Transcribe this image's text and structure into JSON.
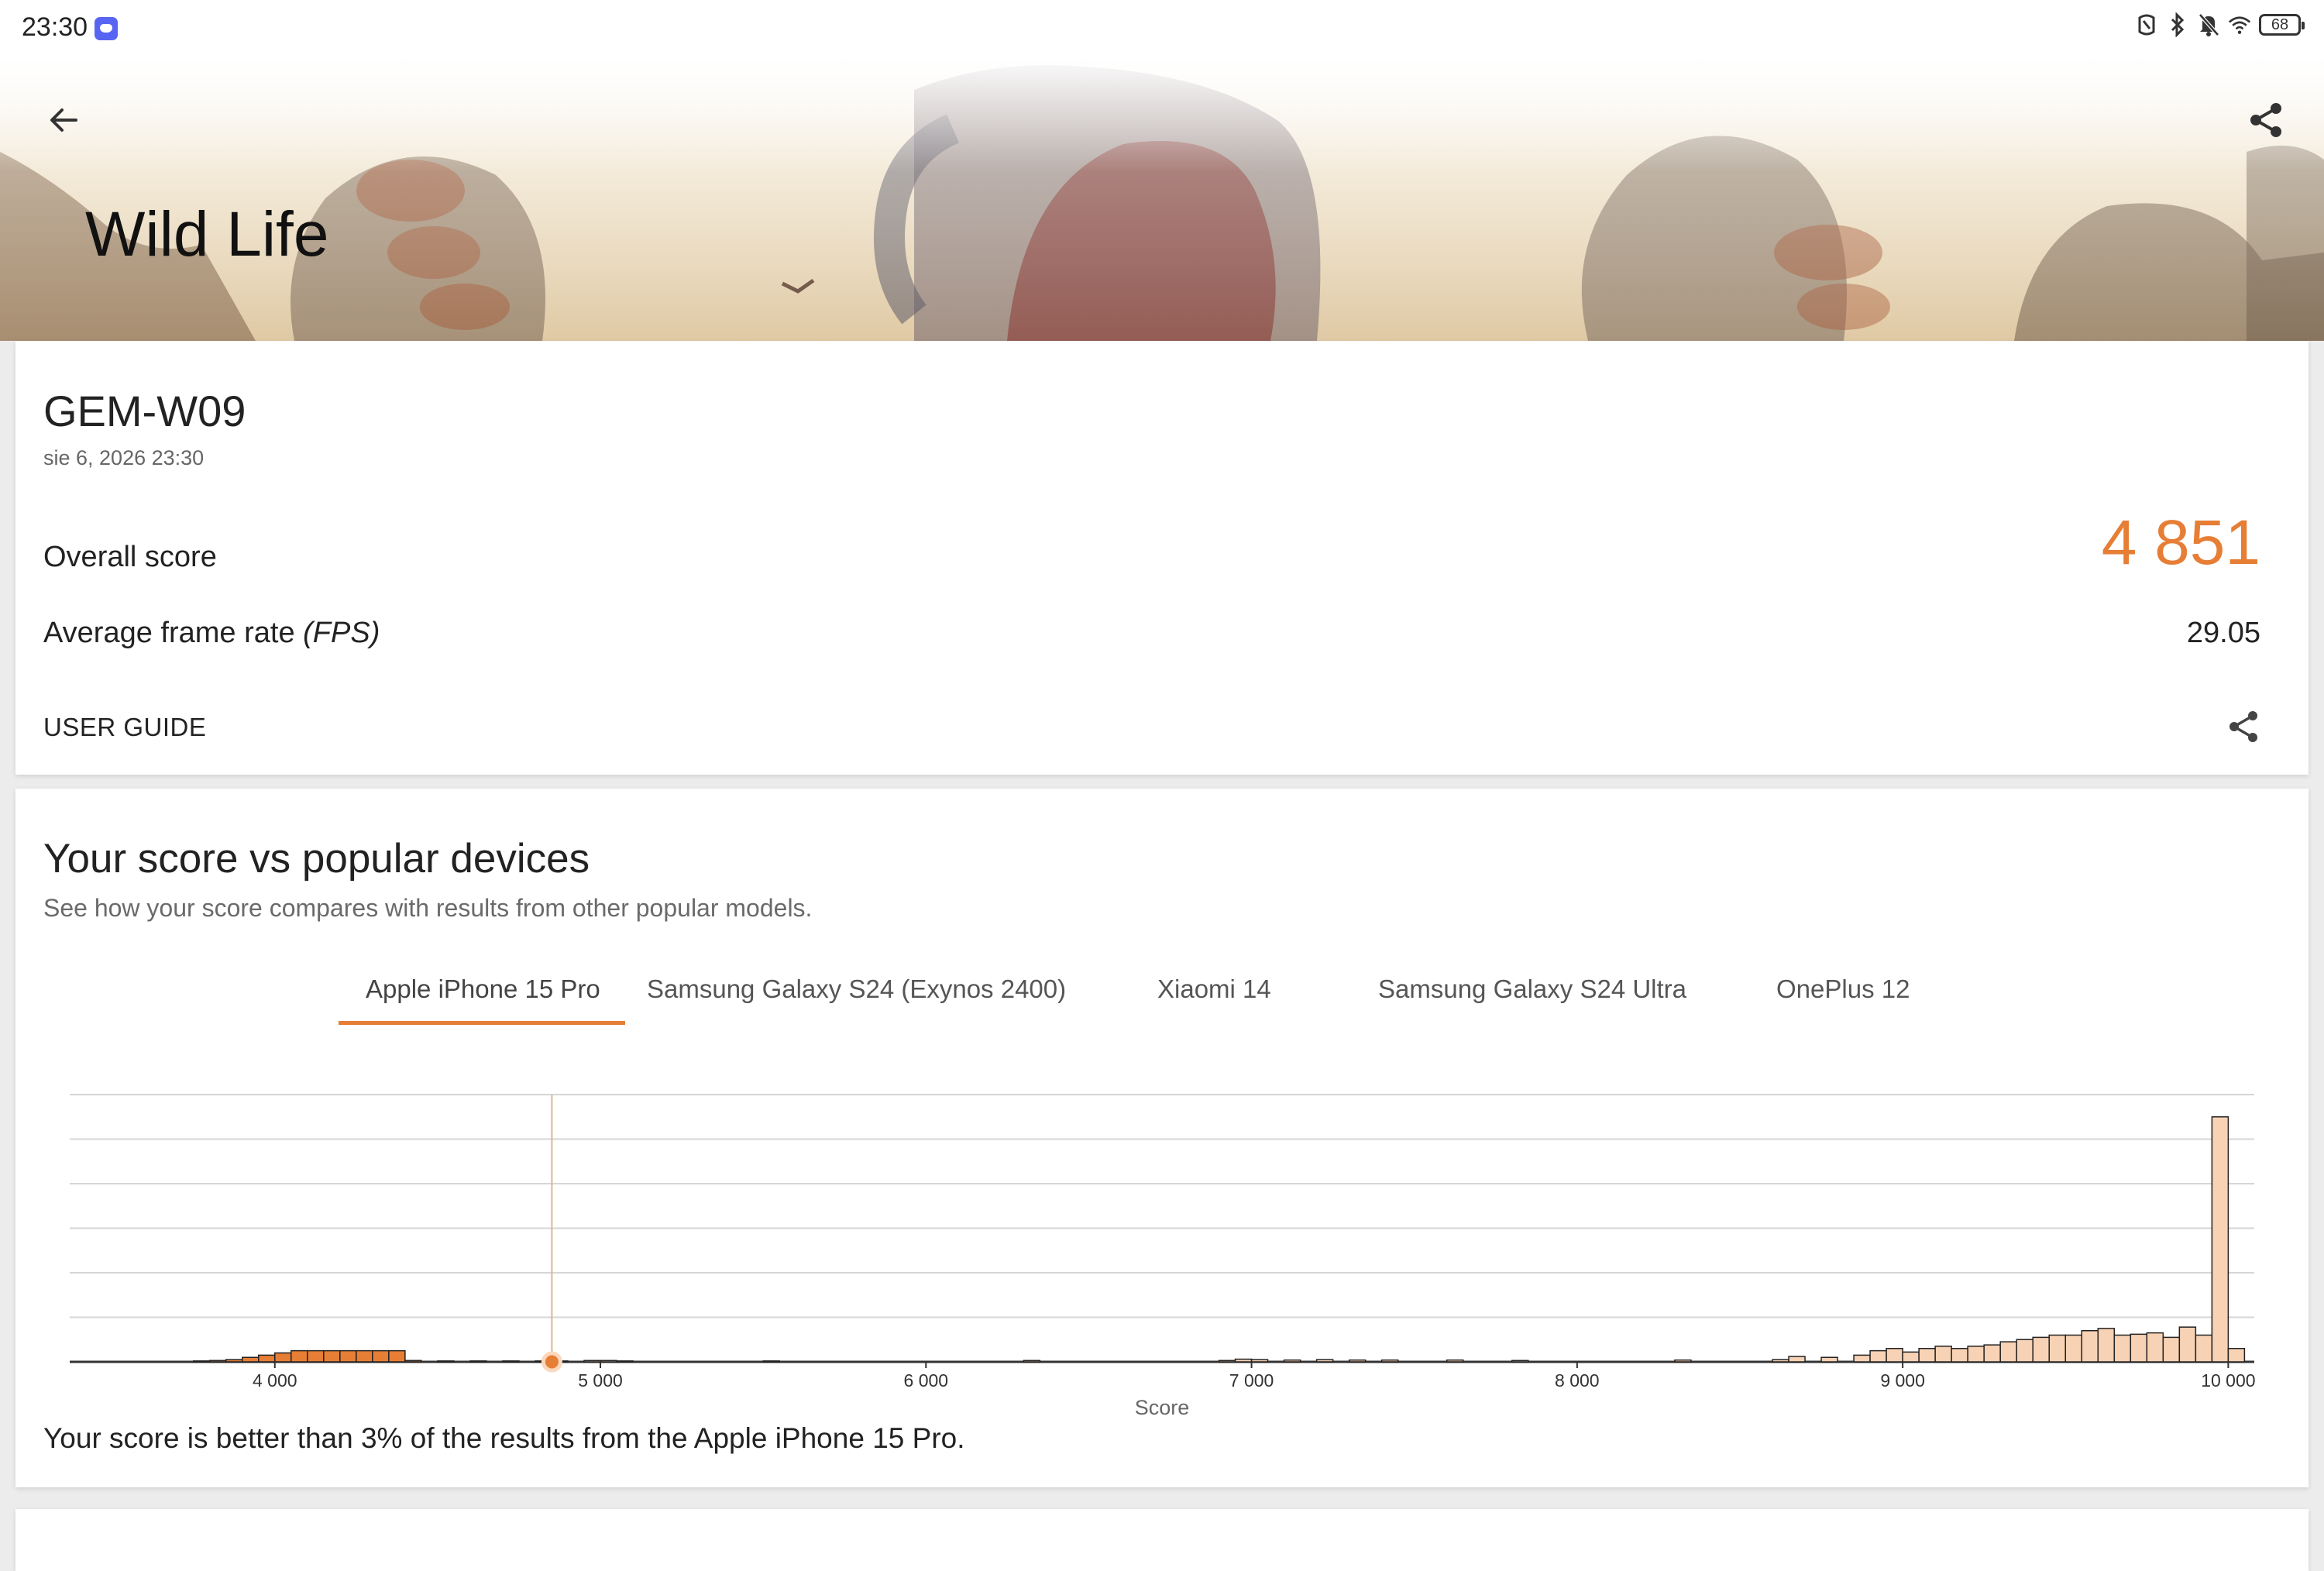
{
  "status_bar": {
    "time": "23:30",
    "battery": "68",
    "icons": [
      "discord-icon",
      "nfc-icon",
      "bluetooth-icon",
      "bell-off-icon",
      "wifi-icon",
      "battery-icon"
    ]
  },
  "header": {
    "title": "Wild Life",
    "back_icon": "arrow-left-icon",
    "share_icon": "share-icon"
  },
  "result": {
    "device": "GEM-W09",
    "date": "sie 6, 2026 23:30",
    "overall_label": "Overall score",
    "overall_value": "4 851",
    "fps_label_main": "Average frame rate",
    "fps_label_unit": "(FPS)",
    "fps_value": "29.05",
    "user_guide": "USER GUIDE"
  },
  "comparison": {
    "title": "Your score vs popular devices",
    "subtitle": "See how your score compares with results from other popular models.",
    "tabs": [
      {
        "label": "Apple iPhone 15 Pro",
        "selected": true
      },
      {
        "label": "Samsung Galaxy S24 (Exynos 2400)",
        "selected": false
      },
      {
        "label": "Xiaomi 14",
        "selected": false
      },
      {
        "label": "Samsung Galaxy S24 Ultra",
        "selected": false
      },
      {
        "label": "OnePlus 12",
        "selected": false
      }
    ],
    "result_text": "Your score is better than 3% of the results from the Apple iPhone 15 Pro."
  },
  "chart_data": {
    "type": "area",
    "xlabel": "Score",
    "xlim": [
      3370,
      10080
    ],
    "ylim": [
      0,
      6
    ],
    "grid": true,
    "x_ticks": [
      4000,
      5000,
      6000,
      7000,
      8000,
      9000,
      10000
    ],
    "x_tick_labels": [
      "4 000",
      "5 000",
      "6 000",
      "7 000",
      "8 000",
      "9 000",
      "10 000"
    ],
    "marker": {
      "x": 4851
    },
    "bin_width": 50,
    "series": [
      {
        "color": "#e67e35",
        "highlight_below": 4851,
        "points": [
          [
            3750,
            0.02
          ],
          [
            3800,
            0.03
          ],
          [
            3850,
            0.05
          ],
          [
            3900,
            0.1
          ],
          [
            3950,
            0.15
          ],
          [
            4000,
            0.2
          ],
          [
            4050,
            0.25
          ],
          [
            4100,
            0.25
          ],
          [
            4150,
            0.25
          ],
          [
            4200,
            0.25
          ],
          [
            4250,
            0.25
          ],
          [
            4300,
            0.25
          ],
          [
            4350,
            0.25
          ],
          [
            4400,
            0.03
          ],
          [
            4500,
            0.02
          ],
          [
            4600,
            0.02
          ],
          [
            4700,
            0.02
          ],
          [
            4800,
            0.02
          ],
          [
            4850,
            0.02
          ],
          [
            4950,
            0.03
          ],
          [
            5000,
            0.03
          ],
          [
            5050,
            0.02
          ],
          [
            5500,
            0.02
          ],
          [
            6300,
            0.03
          ],
          [
            6900,
            0.03
          ],
          [
            6950,
            0.06
          ],
          [
            7000,
            0.05
          ],
          [
            7100,
            0.04
          ],
          [
            7200,
            0.05
          ],
          [
            7300,
            0.04
          ],
          [
            7400,
            0.04
          ],
          [
            7600,
            0.04
          ],
          [
            7800,
            0.03
          ],
          [
            8300,
            0.04
          ],
          [
            8600,
            0.05
          ],
          [
            8650,
            0.12
          ],
          [
            8750,
            0.1
          ],
          [
            8850,
            0.15
          ],
          [
            8900,
            0.25
          ],
          [
            8950,
            0.3
          ],
          [
            9000,
            0.22
          ],
          [
            9050,
            0.3
          ],
          [
            9100,
            0.35
          ],
          [
            9150,
            0.3
          ],
          [
            9200,
            0.35
          ],
          [
            9250,
            0.38
          ],
          [
            9300,
            0.45
          ],
          [
            9350,
            0.5
          ],
          [
            9400,
            0.55
          ],
          [
            9450,
            0.6
          ],
          [
            9500,
            0.6
          ],
          [
            9550,
            0.7
          ],
          [
            9600,
            0.75
          ],
          [
            9650,
            0.6
          ],
          [
            9700,
            0.62
          ],
          [
            9750,
            0.65
          ],
          [
            9800,
            0.55
          ],
          [
            9850,
            0.78
          ],
          [
            9900,
            0.6
          ],
          [
            9950,
            5.5
          ],
          [
            10000,
            0.3
          ]
        ]
      }
    ]
  }
}
